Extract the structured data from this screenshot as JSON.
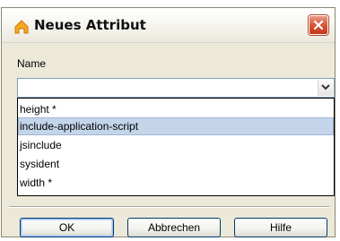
{
  "dialog": {
    "title": "Neues Attribut"
  },
  "name_field": {
    "label": "Name",
    "value": "",
    "options": [
      "height *",
      "include-application-script",
      "jsinclude",
      "sysident",
      "width *"
    ],
    "highlighted_option": "include-application-script"
  },
  "buttons": {
    "ok": "OK",
    "cancel": "Abbrechen",
    "help": "Hilfe"
  },
  "icons": {
    "app": "orange-house-icon",
    "close": "close-icon",
    "dropdown": "chevron-down-icon"
  }
}
